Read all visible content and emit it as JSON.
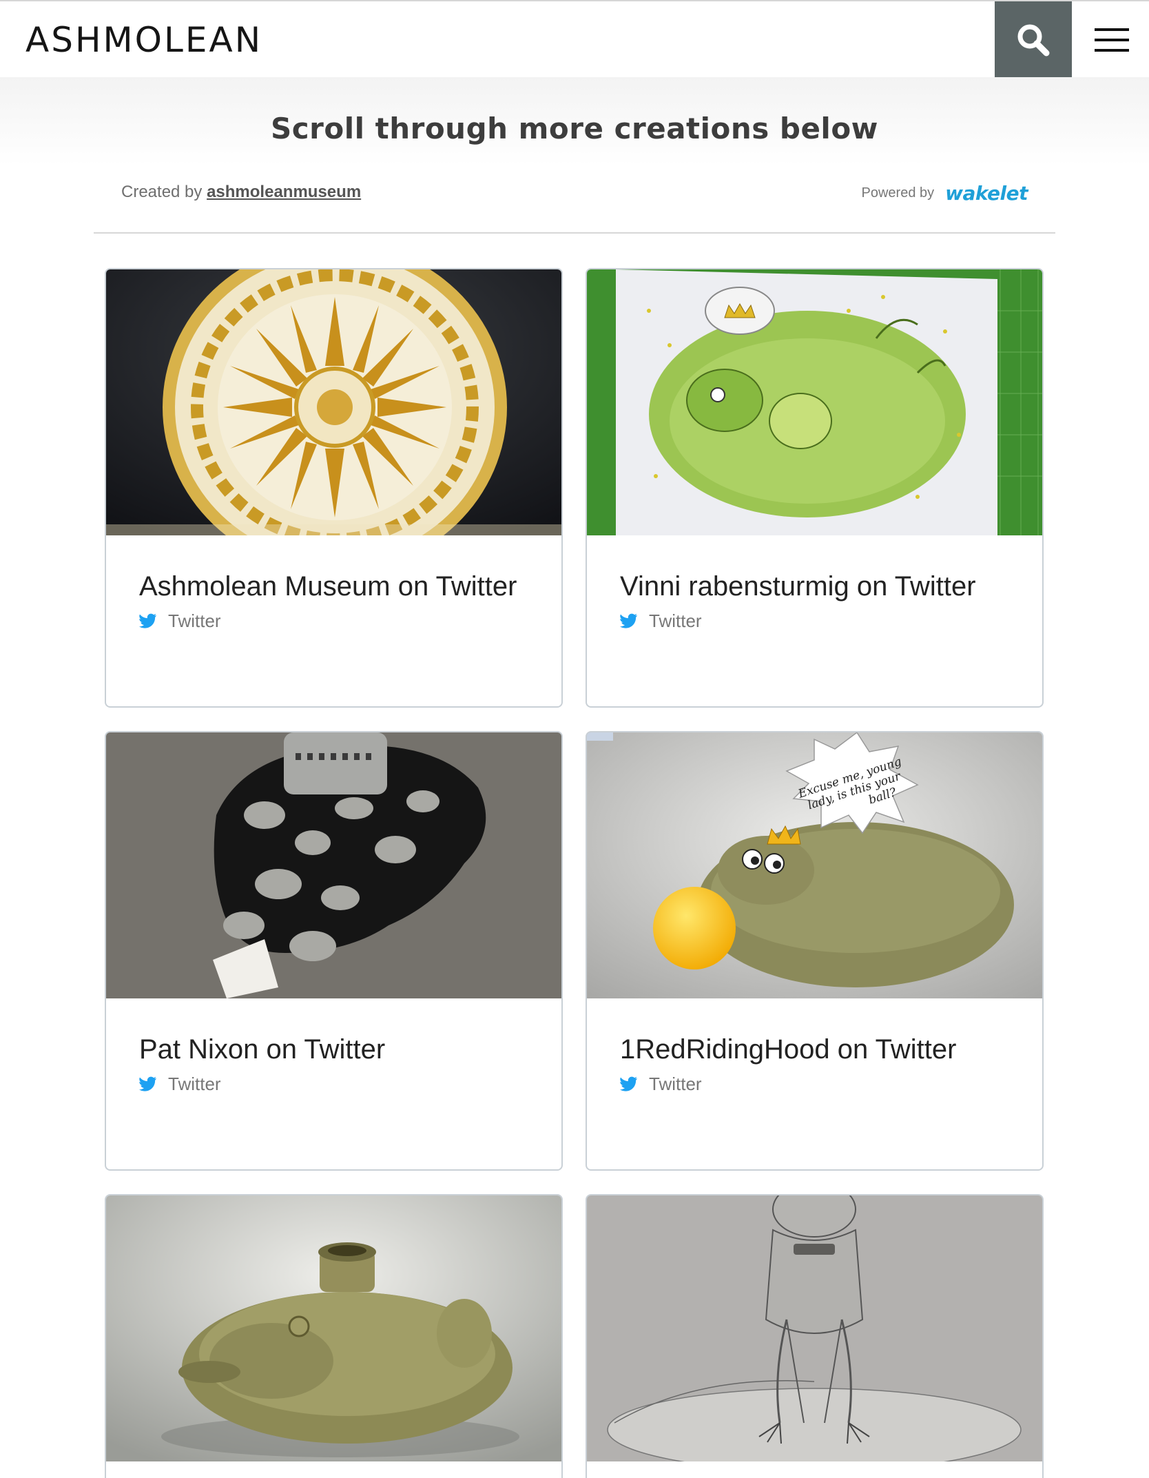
{
  "header": {
    "logo_text": "ASHMOLEAN",
    "search_icon": "search-icon",
    "menu_icon": "hamburger-menu-icon",
    "search_bg_color": "#5b6566"
  },
  "collection": {
    "title": "Scroll through more creations below",
    "created_by_label": "Created by",
    "creator": "ashmoleanmuseum",
    "powered_by_label": "Powered by",
    "powered_by_brand": "wakelet",
    "brand_color": "#1fa0d8"
  },
  "cards": [
    {
      "title": "Ashmolean Museum on Twitter",
      "source": "Twitter",
      "source_icon": "twitter-bird-icon"
    },
    {
      "title": "Vinni rabensturmig on Twitter",
      "source": "Twitter",
      "source_icon": "twitter-bird-icon"
    },
    {
      "title": "Pat Nixon on Twitter",
      "source": "Twitter",
      "source_icon": "twitter-bird-icon"
    },
    {
      "title": "1RedRidingHood on Twitter",
      "source": "Twitter",
      "source_icon": "twitter-bird-icon",
      "image_caption": "Excuse me, young lady, is this your ball?"
    },
    {
      "title": "",
      "source": ""
    },
    {
      "title": "",
      "source": ""
    }
  ]
}
